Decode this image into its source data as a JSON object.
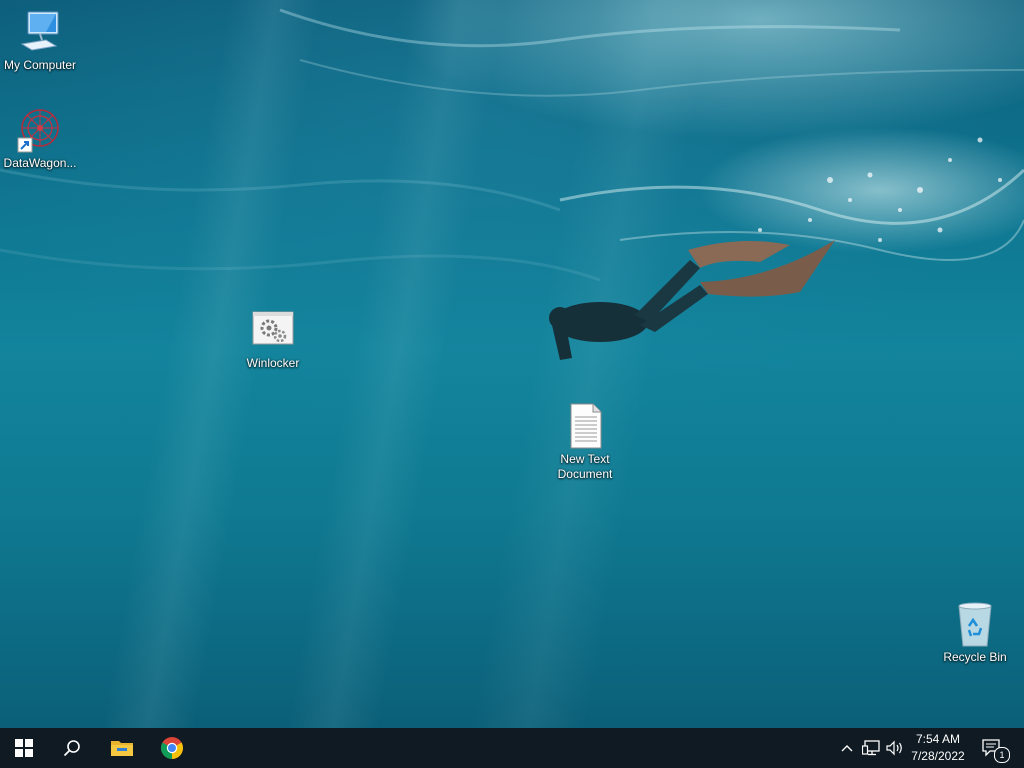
{
  "desktop": {
    "icons": {
      "my_computer": "My Computer",
      "datawagon": "DataWagon...",
      "winlocker": "Winlocker",
      "new_text_document": "New Text Document",
      "recycle_bin": "Recycle Bin"
    }
  },
  "taskbar": {
    "pinned": [
      "start-icon",
      "search-icon",
      "file-explorer-icon",
      "chrome-icon"
    ],
    "tray": {
      "time": "7:54 AM",
      "date": "7/28/2022",
      "notification_count": "1"
    }
  },
  "colors": {
    "taskbar_bg": "#0f1a22",
    "water_deep": "#0b5f78",
    "water_mid": "#12849c"
  }
}
